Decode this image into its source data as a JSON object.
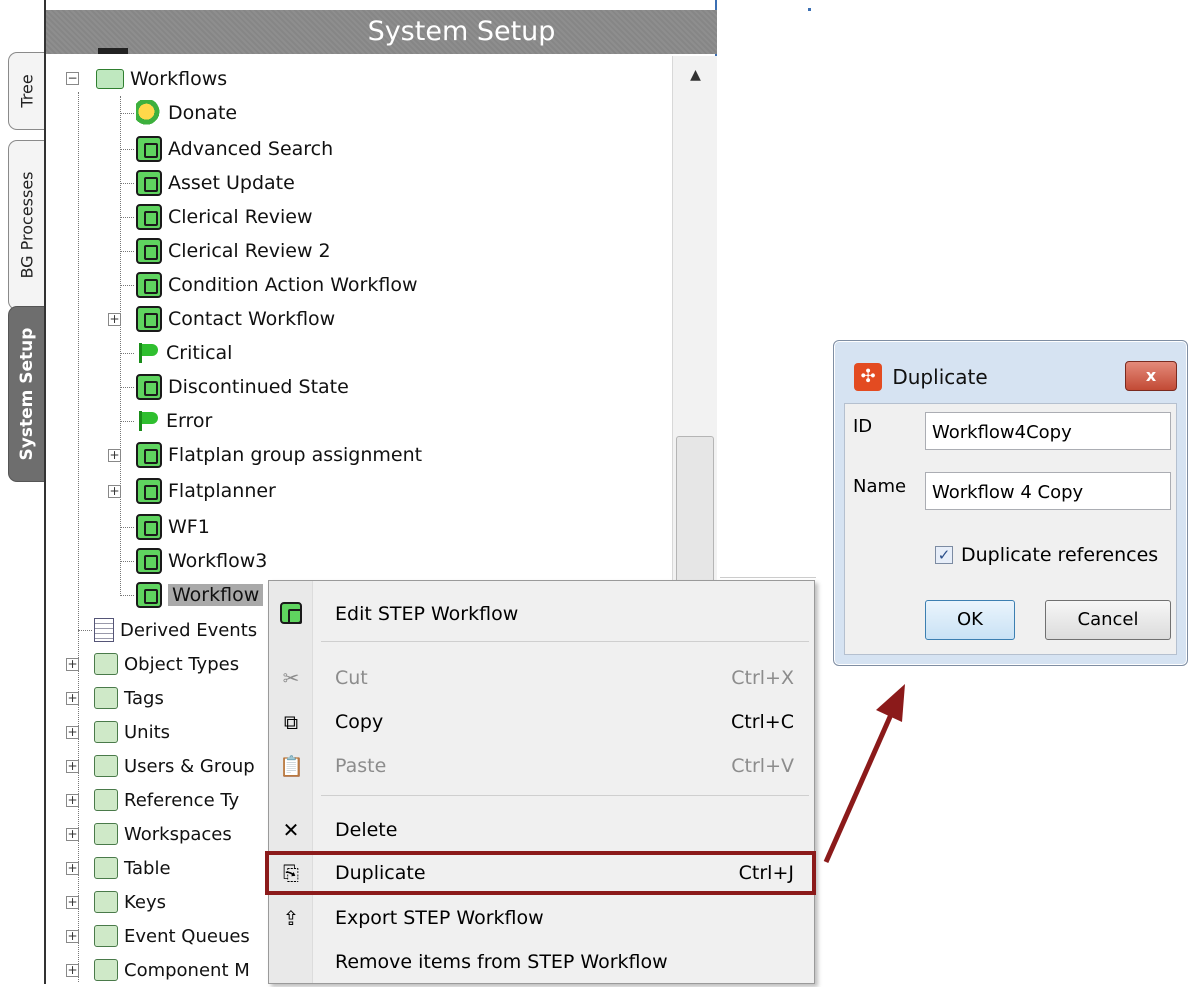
{
  "tabs": [
    {
      "label": "Tree",
      "selected": false
    },
    {
      "label": "BG Processes",
      "selected": false
    },
    {
      "label": "System Setup",
      "selected": true
    }
  ],
  "panel": {
    "title": "System Setup"
  },
  "tree": {
    "root": {
      "label": "Workflows",
      "expanded": true
    },
    "children": [
      {
        "label": "Donate",
        "icon": "donate-icon"
      },
      {
        "label": "Advanced Search",
        "icon": "workflow-icon"
      },
      {
        "label": "Asset Update",
        "icon": "workflow-icon"
      },
      {
        "label": "Clerical Review",
        "icon": "workflow-icon"
      },
      {
        "label": "Clerical Review 2",
        "icon": "workflow-icon"
      },
      {
        "label": "Condition Action Workflow",
        "icon": "workflow-icon"
      },
      {
        "label": "Contact Workflow",
        "icon": "workflow-icon",
        "expandable": true
      },
      {
        "label": "Critical",
        "icon": "flag-icon"
      },
      {
        "label": "Discontinued State",
        "icon": "workflow-icon"
      },
      {
        "label": "Error",
        "icon": "flag-icon"
      },
      {
        "label": "Flatplan group assignment",
        "icon": "workflow-icon",
        "expandable": true
      },
      {
        "label": "Flatplanner",
        "icon": "workflow-icon",
        "expandable": true
      },
      {
        "label": "WF1",
        "icon": "workflow-icon"
      },
      {
        "label": "Workflow3",
        "icon": "workflow-icon"
      },
      {
        "label": "Workflow",
        "icon": "workflow-icon",
        "selected": true
      }
    ],
    "siblings": [
      {
        "label": "Derived Events",
        "icon": "document-icon"
      },
      {
        "label": "Object Types",
        "icon": "object-types-icon",
        "expandable": true
      },
      {
        "label": "Tags",
        "icon": "tags-icon",
        "expandable": true
      },
      {
        "label": "Units",
        "icon": "ruler-icon",
        "expandable": true
      },
      {
        "label": "Users & Group",
        "icon": "users-icon",
        "expandable": true
      },
      {
        "label": "Reference Ty",
        "icon": "reference-icon",
        "expandable": true
      },
      {
        "label": "Workspaces",
        "icon": "workspaces-icon",
        "expandable": true
      },
      {
        "label": "Table",
        "icon": "table-icon",
        "expandable": true
      },
      {
        "label": "Keys",
        "icon": "keys-icon",
        "expandable": true
      },
      {
        "label": "Event Queues",
        "icon": "event-queue-icon",
        "expandable": true
      },
      {
        "label": "Component M",
        "icon": "component-icon",
        "expandable": true
      }
    ]
  },
  "context_menu": {
    "items": [
      {
        "label": "Edit STEP Workflow",
        "shortcut": "",
        "enabled": true,
        "icon": "workflow-icon"
      },
      {
        "label": "Cut",
        "shortcut": "Ctrl+X",
        "enabled": false,
        "icon": "scissors-icon"
      },
      {
        "label": "Copy",
        "shortcut": "Ctrl+C",
        "enabled": true,
        "icon": "copy-icon"
      },
      {
        "label": "Paste",
        "shortcut": "Ctrl+V",
        "enabled": false,
        "icon": "paste-icon"
      },
      {
        "label": "Delete",
        "shortcut": "",
        "enabled": true,
        "icon": "delete-icon"
      },
      {
        "label": "Duplicate",
        "shortcut": "Ctrl+J",
        "enabled": true,
        "icon": "duplicate-icon",
        "highlighted": true
      },
      {
        "label": "Export STEP Workflow",
        "shortcut": "",
        "enabled": true,
        "icon": "export-icon"
      },
      {
        "label": "Remove items from STEP Workflow",
        "shortcut": "",
        "enabled": true,
        "icon": ""
      }
    ]
  },
  "dialog": {
    "title": "Duplicate",
    "close_label": "x",
    "id_label": "ID",
    "id_value": "Workflow4Copy",
    "name_label": "Name",
    "name_value": "Workflow 4 Copy",
    "checkbox_label": "Duplicate references",
    "checkbox_checked": true,
    "ok_label": "OK",
    "cancel_label": "Cancel"
  },
  "colors": {
    "highlight_border": "#8b1a1a",
    "arrow": "#8b1a1a",
    "panel_title_bg": "#8a8a8a",
    "workflow_icon": "#5fd45f"
  }
}
